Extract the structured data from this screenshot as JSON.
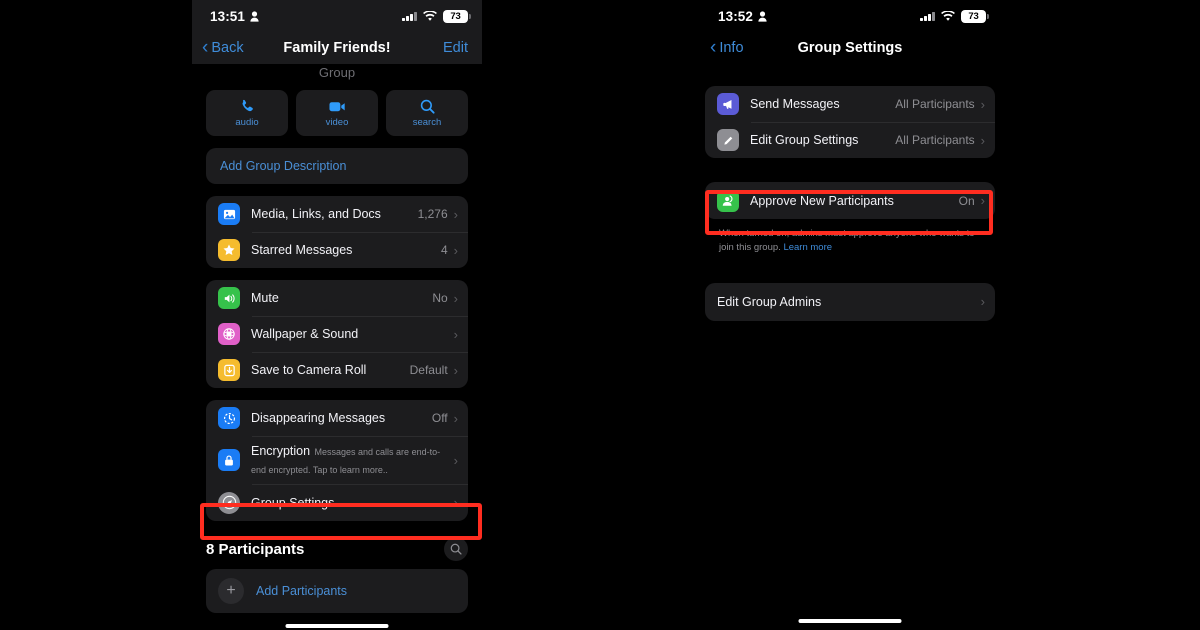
{
  "left_phone": {
    "status_bar": {
      "time": "13:51",
      "person_icon": "person-icon",
      "battery": "73",
      "signal_icon": "cellular-signal-icon",
      "wifi_icon": "wifi-icon"
    },
    "nav": {
      "back_label": "Back",
      "title": "Family Friends!",
      "right_label": "Edit"
    },
    "ghost_label": "Group",
    "actions": [
      {
        "icon": "phone-icon",
        "label": "audio"
      },
      {
        "icon": "video-camera-icon",
        "label": "video"
      },
      {
        "icon": "search-icon",
        "label": "search"
      }
    ],
    "add_description": "Add Group Description",
    "group_media": [
      {
        "icon": "photos-icon",
        "icon_color": "#1a7cf5",
        "title": "Media, Links, and Docs",
        "value": "1,276"
      },
      {
        "icon": "star-icon",
        "icon_color": "#f5bc2e",
        "title": "Starred Messages",
        "value": "4"
      }
    ],
    "group_prefs": [
      {
        "icon": "speaker-icon",
        "icon_color": "#36c24b",
        "title": "Mute",
        "value": "No"
      },
      {
        "icon": "wallpaper-icon",
        "icon_color": "#e060c8",
        "title": "Wallpaper & Sound",
        "value": ""
      },
      {
        "icon": "download-icon",
        "icon_color": "#f5bc2e",
        "title": "Save to Camera Roll",
        "value": "Default"
      }
    ],
    "group_privacy": [
      {
        "icon": "timer-icon",
        "icon_color": "#1a7cf5",
        "title": "Disappearing Messages",
        "value": "Off",
        "subtitle": ""
      },
      {
        "icon": "lock-icon",
        "icon_color": "#1a7cf5",
        "title": "Encryption",
        "value": "",
        "subtitle": "Messages and calls are end-to-end encrypted. Tap to learn more.."
      },
      {
        "icon": "gear-icon",
        "icon_color": "#8e8e93",
        "title": "Group Settings",
        "value": "",
        "subtitle": ""
      }
    ],
    "participants": {
      "heading": "8 Participants",
      "search_icon": "search-icon",
      "add_label": "Add Participants",
      "add_icon": "plus-icon"
    }
  },
  "right_phone": {
    "status_bar": {
      "time": "13:52",
      "person_icon": "person-icon",
      "battery": "73",
      "signal_icon": "cellular-signal-icon",
      "wifi_icon": "wifi-icon"
    },
    "nav": {
      "back_label": "Info",
      "title": "Group Settings",
      "right_label": ""
    },
    "permissions": [
      {
        "icon": "megaphone-icon",
        "icon_color": "#5b5bd6",
        "title": "Send Messages",
        "value": "All Participants"
      },
      {
        "icon": "pencil-icon",
        "icon_color": "#8e8e93",
        "title": "Edit Group Settings",
        "value": "All Participants"
      }
    ],
    "approve": {
      "icon": "approve-participants-icon",
      "icon_color": "#36c24b",
      "title": "Approve New Participants",
      "value": "On"
    },
    "note_text": "When turned on, admins must approve anyone who wants to join this group. ",
    "note_link": "Learn more",
    "admins": {
      "title": "Edit Group Admins"
    }
  },
  "highlight_color": "#ff2d20"
}
